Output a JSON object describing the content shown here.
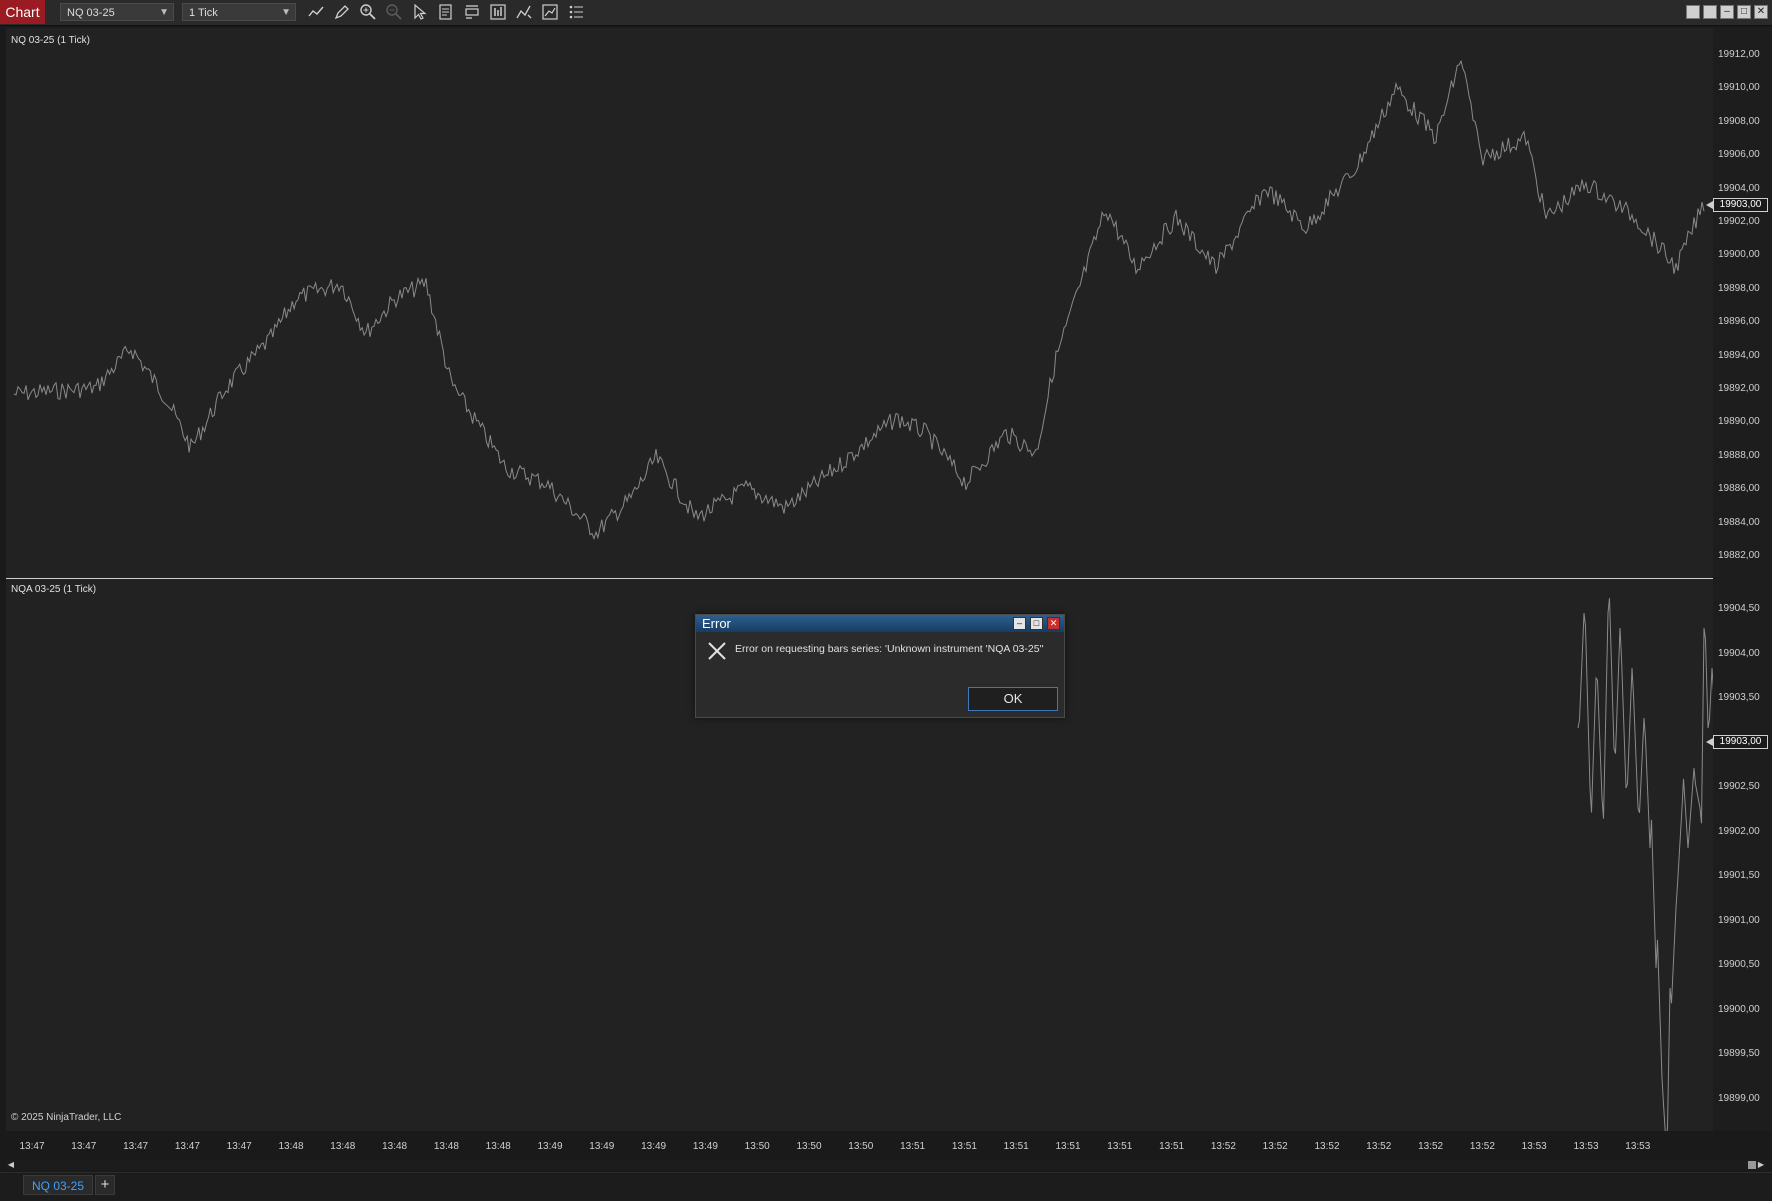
{
  "toolbar": {
    "app_badge": "Chart",
    "instrument": "NQ 03-25",
    "interval": "1 Tick",
    "tools": [
      "line-tool-icon",
      "draw-tool-icon",
      "zoom-in-icon",
      "zoom-out-icon",
      "pointer-icon",
      "properties-icon",
      "data-box-icon",
      "instrument-icon",
      "indicators-icon",
      "strategies-icon",
      "chart-trader-icon"
    ]
  },
  "panes": {
    "top_label": "NQ 03-25 (1 Tick)",
    "bottom_label": "NQA 03-25 (1 Tick)"
  },
  "yaxis_top": [
    "19912,00",
    "19910,00",
    "19908,00",
    "19906,00",
    "19904,00",
    "19902,00",
    "19900,00",
    "19898,00",
    "19896,00",
    "19894,00",
    "19892,00",
    "19890,00",
    "19888,00",
    "19886,00",
    "19884,00",
    "19882,00"
  ],
  "yaxis_bottom": [
    "19904,50",
    "19904,00",
    "19903,50",
    "19902,50",
    "19902,00",
    "19901,50",
    "19901,00",
    "19900,50",
    "19900,00",
    "19899,50",
    "19899,00"
  ],
  "price_tag_top": "19903,00",
  "price_tag_bottom": "19903,00",
  "xaxis": [
    "13:47",
    "13:47",
    "13:47",
    "13:47",
    "13:47",
    "13:48",
    "13:48",
    "13:48",
    "13:48",
    "13:48",
    "13:49",
    "13:49",
    "13:49",
    "13:49",
    "13:50",
    "13:50",
    "13:50",
    "13:51",
    "13:51",
    "13:51",
    "13:51",
    "13:51",
    "13:51",
    "13:52",
    "13:52",
    "13:52",
    "13:52",
    "13:52",
    "13:52",
    "13:53",
    "13:53",
    "13:53"
  ],
  "copyright": "© 2025 NinjaTrader, LLC",
  "tabs": {
    "active": "NQ 03-25",
    "add": "+"
  },
  "dialog": {
    "title": "Error",
    "message": "Error on requesting bars series: 'Unknown instrument 'NQA 03-25''",
    "ok": "OK"
  },
  "colors": {
    "background": "#222222",
    "line": "#8a8a8a",
    "badge": "#9b1b22",
    "tab_text": "#3ea0ff"
  }
}
